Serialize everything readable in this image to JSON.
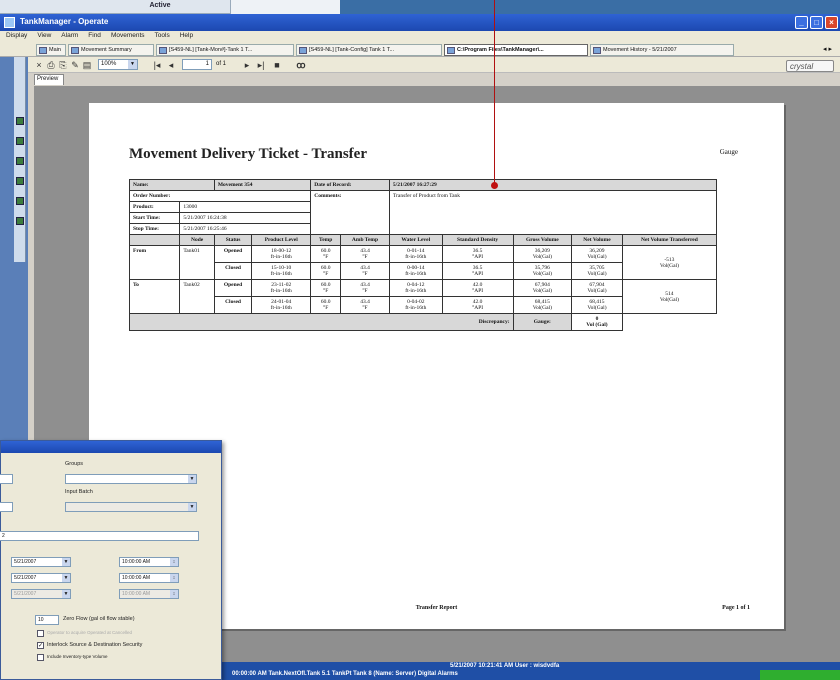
{
  "background_window": {
    "header": "Active"
  },
  "window": {
    "title": "TankManager - Operate"
  },
  "menu": [
    "Display",
    "View",
    "Alarm",
    "Find",
    "Movements",
    "Tools",
    "Help"
  ],
  "tabs": [
    "Main",
    "Movement Summary",
    "[S459-NL] [Tank-Mon#]-Tank 1 T...",
    "[S459-NL] [Tank-Config] Tank 1 T...",
    "C:\\Program Files\\TankManager\\...",
    "Movement History - 5/21/2007"
  ],
  "toolbar": {
    "zoom": "100%",
    "page_current": "1",
    "page_total": "of 1",
    "brand": "crystal"
  },
  "preview_tab": "Preview",
  "report": {
    "title": "Movement Delivery Ticket -   Transfer",
    "gauge_header": "Gauge",
    "name_label": "Name:",
    "name_value": "Movement 354",
    "date_label": "Date of Record:",
    "date_value": "5/21/2007 16:27:29",
    "order_label": "Order Number:",
    "product_label": "Product:",
    "product_value": "13000",
    "comments_label": "Comments:",
    "comments_value": "Transfer of Product from Tank",
    "start_label": "Start Time:",
    "start_value": "5/21/2007 16:24:38",
    "stop_label": "Stop Time:",
    "stop_value": "5/21/2007 16:25:46",
    "columns": [
      "Node",
      "Status",
      "Product Level",
      "Temp",
      "Amb Temp",
      "Water Level",
      "Standard Density",
      "Gross Volume",
      "Net Volume",
      "Net Volume Transferred"
    ],
    "from_label": "From",
    "to_label": "To",
    "from_node": "Tank01",
    "to_node": "Tank02",
    "rows": [
      {
        "status": "Opened",
        "level": "18-00-12",
        "level_u": "ft-in-16th",
        "temp": "60.0",
        "temp_u": "°F",
        "amb": "43.4",
        "amb_u": "°F",
        "water": "0-01-14",
        "water_u": "ft-in-16th",
        "density": "36.5",
        "density_u": "°API",
        "gross": "36,209",
        "gross_u": "Vol(Gal)",
        "net": "36,209",
        "net_u": "Vol(Gal)"
      },
      {
        "status": "Closed",
        "level": "15-10-10",
        "level_u": "ft-in-16th",
        "temp": "60.0",
        "temp_u": "°F",
        "amb": "43.4",
        "amb_u": "°F",
        "water": "0-00-14",
        "water_u": "ft-in-16th",
        "density": "36.5",
        "density_u": "°API",
        "gross": "35,796",
        "gross_u": "Vol(Gal)",
        "net": "35,705",
        "net_u": "Vol(Gal)"
      },
      {
        "status": "Opened",
        "level": "23-11-02",
        "level_u": "ft-in-16th",
        "temp": "60.0",
        "temp_u": "°F",
        "amb": "43.4",
        "amb_u": "°F",
        "water": "0-04-12",
        "water_u": "ft-in-16th",
        "density": "42.0",
        "density_u": "°API",
        "gross": "67,904",
        "gross_u": "Vol(Gal)",
        "net": "67,904",
        "net_u": "Vol(Gal)"
      },
      {
        "status": "Closed",
        "level": "24-01-04",
        "level_u": "ft-in-16th",
        "temp": "60.0",
        "temp_u": "°F",
        "amb": "43.4",
        "amb_u": "°F",
        "water": "0-04-02",
        "water_u": "ft-in-16th",
        "density": "42.0",
        "density_u": "°API",
        "gross": "68,415",
        "gross_u": "Vol(Gal)",
        "net": "68,415",
        "net_u": "Vol(Gal)"
      }
    ],
    "transfer_from": "-513",
    "transfer_from_u": "Vol(Gal)",
    "transfer_to": "514",
    "transfer_to_u": "Vol(Gal)",
    "discrepancy_label": "Discrepancy:",
    "gauge_label": "Gauge:",
    "discrepancy_value": "0",
    "discrepancy_u": "Vol (Gal)",
    "footer_title": "Transfer Report",
    "footer_page": "Page 1 of 1"
  },
  "status": {
    "line1": "5/21/2007  10:21:41 AM    User : wisdvdfa",
    "line2": "00:00:00 AM    Tank.NextOfl.Tank 5.1 TankPt  Tank 8 (Name: Server)  Digital Alarms"
  },
  "dialog": {
    "groups_label": "Groups",
    "input_batch_label": "Input Batch",
    "id_value": "2",
    "date1": "5/21/2007",
    "time1": "10:00:00 AM",
    "date2": "5/21/2007",
    "time2": "10:00:00 AM",
    "date3": "5/21/2007",
    "time3": "10:00:00 AM",
    "zero_value": "10",
    "zero_label": "Zero Flow (gal oil flow stable)",
    "option_disabled": "Operator to acquire Operated at Cancelled",
    "interlock_label": "Interlock Source & Destination Security",
    "include_label": "Include Inventory-type Volume"
  },
  "colors": {
    "desktop": "#3a6ea5",
    "titlebar": "#1c48b0",
    "pointer": "#b01010",
    "status_green": "#2fae2f"
  }
}
